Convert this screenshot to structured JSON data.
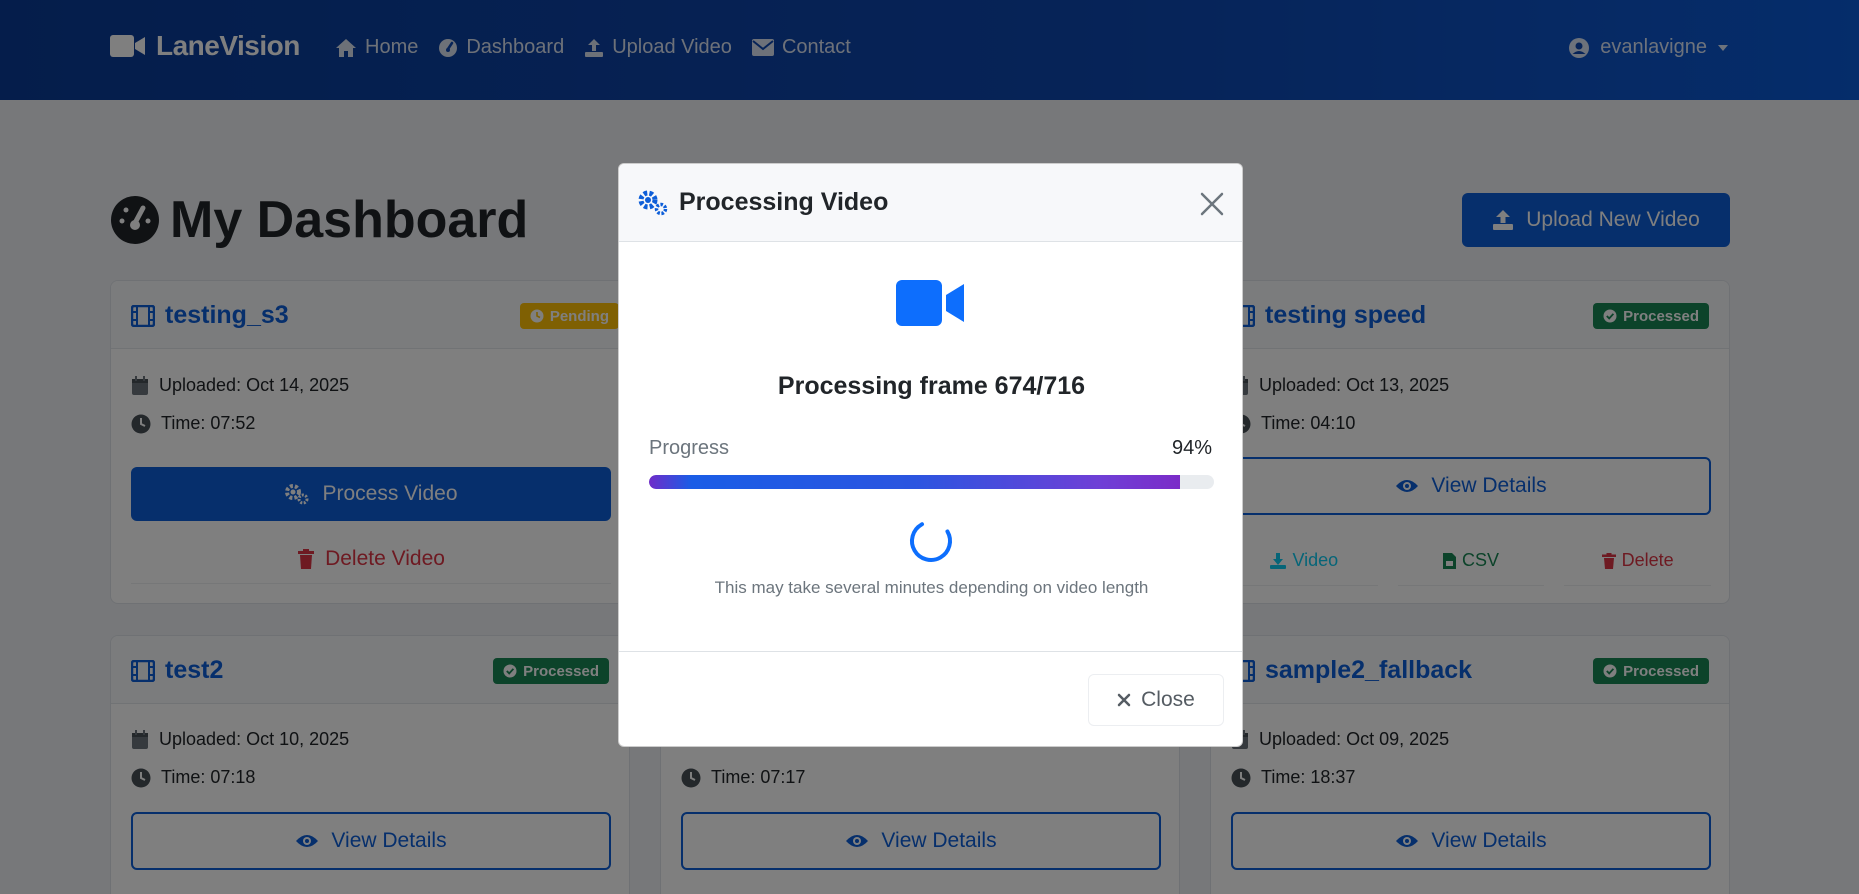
{
  "navbar": {
    "brand": "LaneVision",
    "links": [
      {
        "label": "Home",
        "icon": "home-icon"
      },
      {
        "label": "Dashboard",
        "icon": "gauge-icon"
      },
      {
        "label": "Upload Video",
        "icon": "upload-icon"
      },
      {
        "label": "Contact",
        "icon": "envelope-icon"
      }
    ],
    "username": "evanlavigne"
  },
  "page": {
    "title": "My Dashboard",
    "upload_button": "Upload New Video"
  },
  "cards": [
    {
      "title": "testing_s3",
      "status": "Pending",
      "uploaded": "Uploaded: Oct 14, 2025",
      "time": "Time: 07:52",
      "primary_action": "Process Video",
      "delete_action": "Delete Video"
    },
    {
      "title": "testing speed",
      "status": "Processed",
      "uploaded": "Uploaded: Oct 13, 2025",
      "time": "Time: 04:10",
      "primary_action": "View Details",
      "video_action": "Video",
      "csv_action": "CSV",
      "delete_action": "Delete"
    },
    {
      "title": "test2",
      "status": "Processed",
      "uploaded": "Uploaded: Oct 10, 2025",
      "time": "Time: 07:18",
      "primary_action": "View Details"
    },
    {
      "time": "Time: 07:17",
      "primary_action": "View Details"
    },
    {
      "title": "sample2_fallback",
      "status": "Processed",
      "uploaded": "Uploaded: Oct 09, 2025",
      "time": "Time: 18:37",
      "primary_action": "View Details"
    }
  ],
  "modal": {
    "title": "Processing Video",
    "status_text": "Processing frame 674/716",
    "progress_label": "Progress",
    "progress_percent_text": "94%",
    "progress_fraction": 0.94,
    "hint": "This may take several minutes depending on video length",
    "close_button": "Close"
  },
  "colors": {
    "primary": "#0d5ed8",
    "success": "#198754",
    "warning": "#ffc107",
    "danger": "#dc3545"
  }
}
